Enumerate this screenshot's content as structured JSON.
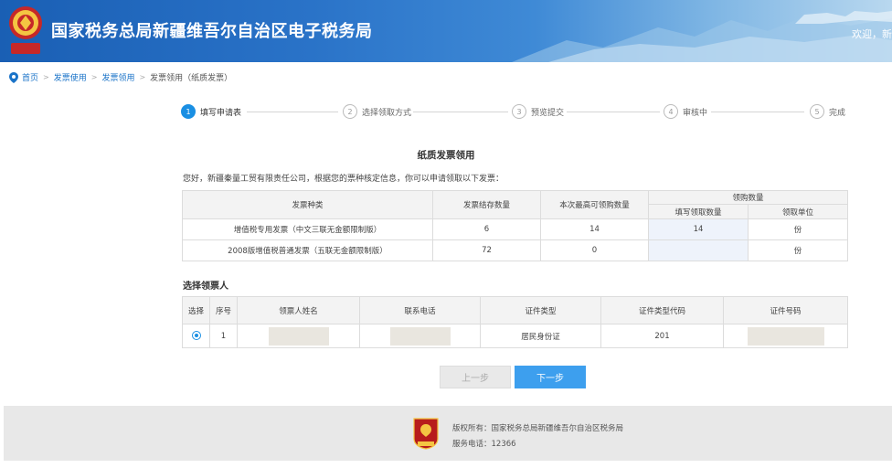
{
  "header": {
    "title": "国家税务总局新疆维吾尔自治区电子税务局",
    "welcome": "欢迎，新"
  },
  "breadcrumb": {
    "items": [
      "首页",
      "发票使用",
      "发票领用",
      "发票领用（纸质发票）"
    ]
  },
  "stepper": {
    "steps": [
      {
        "num": "1",
        "label": "填写申请表",
        "active": true
      },
      {
        "num": "2",
        "label": "选择领取方式",
        "active": false
      },
      {
        "num": "3",
        "label": "预览提交",
        "active": false
      },
      {
        "num": "4",
        "label": "审核中",
        "active": false
      },
      {
        "num": "5",
        "label": "完成",
        "active": false
      }
    ]
  },
  "main": {
    "section_title": "纸质发票领用",
    "intro": "您好，新疆秦量工贸有限责任公司，根据您的票种核定信息，你可以申请领取以下发票："
  },
  "invoice_table": {
    "headers": {
      "type": "发票种类",
      "stock": "发票结存数量",
      "max": "本次最高可领购数量",
      "group": "领购数量",
      "fill": "填写领取数量",
      "unit": "领取单位"
    },
    "rows": [
      {
        "type": "增值税专用发票（中文三联无金额限制版）",
        "stock": "6",
        "max": "14",
        "fill": "14",
        "unit": "份"
      },
      {
        "type": "2008版增值税普通发票（五联无金额限制版）",
        "stock": "72",
        "max": "0",
        "fill": "",
        "unit": "份"
      }
    ]
  },
  "picker": {
    "title": "选择领票人",
    "headers": [
      "选择",
      "序号",
      "领票人姓名",
      "联系电话",
      "证件类型",
      "证件类型代码",
      "证件号码"
    ],
    "rows": [
      {
        "seq": "1",
        "id_type": "居民身份证",
        "id_code": "201"
      }
    ]
  },
  "buttons": {
    "prev": "上一步",
    "next": "下一步"
  },
  "footer": {
    "copyright": "版权所有：国家税务总局新疆维吾尔自治区税务局",
    "phone": "服务电话：12366"
  },
  "colors": {
    "accent": "#1a8fe3",
    "header_blue": "#1a5fb4",
    "button_next": "#3d9fee"
  }
}
